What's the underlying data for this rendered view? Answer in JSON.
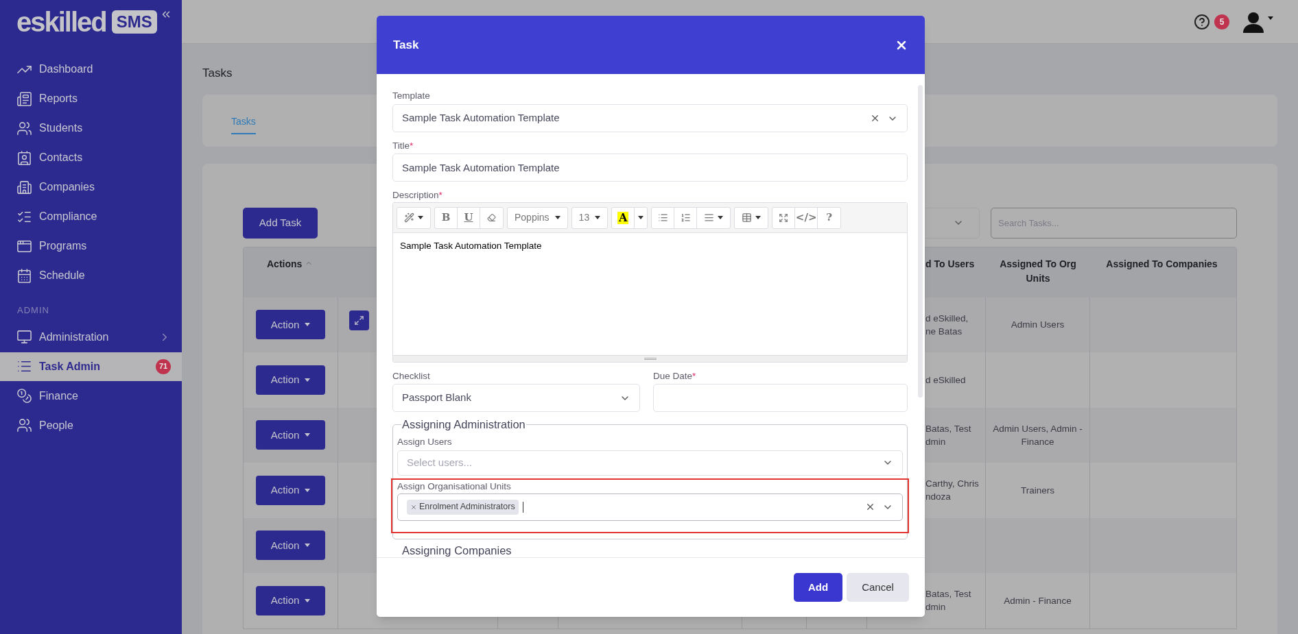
{
  "sidebar": {
    "logo": {
      "wordmark": "eskilled",
      "badge": "SMS"
    },
    "items": [
      {
        "label": "Dashboard",
        "selected": false
      },
      {
        "label": "Reports",
        "selected": false
      },
      {
        "label": "Students",
        "selected": false
      },
      {
        "label": "Contacts",
        "selected": false
      },
      {
        "label": "Companies",
        "selected": false
      },
      {
        "label": "Compliance",
        "selected": false
      },
      {
        "label": "Programs",
        "selected": false
      },
      {
        "label": "Schedule",
        "selected": false
      }
    ],
    "sections": [
      {
        "heading": "ADMIN",
        "items": [
          {
            "label": "Administration",
            "selected": false,
            "expandable": true
          },
          {
            "label": "Task Admin",
            "selected": true,
            "expandable": false,
            "badge": "71"
          },
          {
            "label": "Finance",
            "selected": false,
            "expandable": false
          },
          {
            "label": "People",
            "selected": false,
            "expandable": false
          }
        ]
      }
    ]
  },
  "header": {
    "notifications": "5"
  },
  "page": {
    "title": "Tasks",
    "tabs": [
      {
        "label": "Tasks",
        "selected": true
      }
    ],
    "add_button": "Add Task",
    "search": {
      "placeholder": "Search Tasks..."
    },
    "table": {
      "columns": [
        {
          "label": "Actions",
          "sorted_ascending": true
        },
        {
          "label": "d To Users"
        },
        {
          "label": "Assigned To Org Units"
        },
        {
          "label": "Assigned To Companies"
        }
      ],
      "rows": [
        {
          "action": "Action",
          "expand": true,
          "users": "d eSkilled,\nne Batas",
          "org_units": "Admin Users"
        },
        {
          "action": "Action",
          "expand": false,
          "users": "d eSkilled"
        },
        {
          "action": "Action",
          "expand": false,
          "users": "Batas, Test\ndmin",
          "org_units": "Admin Users, Admin - Finance"
        },
        {
          "action": "Action",
          "expand": false,
          "users": "Carthy, Chris\nndoza",
          "org_units": "Trainers"
        },
        {
          "action": "Action",
          "expand": false
        },
        {
          "action": "Action",
          "expand": false,
          "users": "Batas, Test\ndmin",
          "org_units": "Admin - Finance"
        }
      ]
    }
  },
  "modal": {
    "title": "Task",
    "template": {
      "label": "Template",
      "value": "Sample Task Automation Template",
      "clearable": true
    },
    "title_field": {
      "label": "Title",
      "required_mark": "*",
      "value": "Sample Task Automation Template"
    },
    "description": {
      "label": "Description",
      "required_mark": "*",
      "content": "Sample Task Automation Template",
      "toolbar": [
        [
          {
            "kind": "magic",
            "caret": true
          }
        ],
        [
          {
            "kind": "letter",
            "label": "B"
          },
          {
            "kind": "underline",
            "label": "U"
          },
          {
            "kind": "eraser"
          }
        ],
        [
          {
            "kind": "dropdown",
            "label": "Poppins"
          }
        ],
        [
          {
            "kind": "dropdown",
            "label": "13"
          }
        ],
        [
          {
            "kind": "highlight",
            "label": "A"
          },
          {
            "kind": "caret"
          }
        ],
        [
          {
            "kind": "bullets"
          },
          {
            "kind": "numbers"
          },
          {
            "kind": "align",
            "caret": true
          }
        ],
        [
          {
            "kind": "table",
            "caret": true
          }
        ],
        [
          {
            "kind": "fullscreen"
          },
          {
            "kind": "letter",
            "label": "</>"
          },
          {
            "kind": "letter",
            "label": "?"
          }
        ]
      ]
    },
    "checklist": {
      "label": "Checklist",
      "value": "Passport Blank"
    },
    "due_date": {
      "label": "Due Date",
      "required_mark": "*"
    },
    "fieldsets": [
      {
        "legend": "Assigning Administration",
        "fields": [
          {
            "label": "Assign Users",
            "placeholder": "Select users...",
            "highlighted": false,
            "focused": false
          },
          {
            "label": "Assign Organisational Units",
            "tags": [
              "Enrolment Administrators"
            ],
            "highlighted": true,
            "focused": true
          }
        ]
      },
      {
        "legend": "Assigning Companies"
      }
    ],
    "buttons": [
      {
        "label": "Add",
        "kind": "primary"
      },
      {
        "label": "Cancel",
        "kind": "secondary"
      }
    ]
  }
}
